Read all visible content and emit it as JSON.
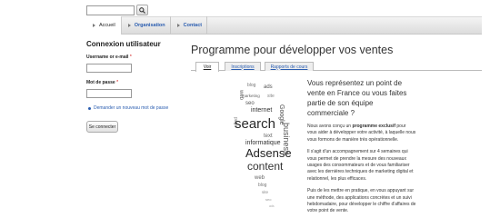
{
  "search": {
    "value": "",
    "button_icon": "search-icon"
  },
  "nav": {
    "items": [
      {
        "label": "Accueil",
        "active": true
      },
      {
        "label": "Organisation",
        "active": false
      },
      {
        "label": "Contact",
        "active": false
      }
    ]
  },
  "login": {
    "title": "Connexion utilisateur",
    "username_label": "Username or e-mail",
    "password_label": "Mot de passe",
    "required_mark": "*",
    "new_password_link": "Demander un nouveau mot de passe",
    "submit_label": "Se connecter"
  },
  "main": {
    "title": "Programme pour développer vos ventes",
    "tabs": [
      {
        "label": "Voir",
        "active": true
      },
      {
        "label": "Inscriptions",
        "active": false
      },
      {
        "label": "Rapports de cours",
        "active": false
      }
    ],
    "lead": "Vous représentez un point de vente en France ou vous faites partie de son équipe commerciale ?",
    "p1_before": "Nous avons conçu un ",
    "p1_strong": "programme exclusif",
    "p1_after": " pour vous aider à développer votre activité, à laquelle nous vous formons de manière très opérationnelle.",
    "p2": "Il s'agit d'un accompagnement sur 4 semaines qui vous permet de prendre la mesure des nouveaux usages des consommateurs et de vous familiariser avec les dernières techniques de marketing digital et relationnel, les plus efficaces.",
    "p3": "Puis de les mettre en pratique, en vous appuyant sur une méthode, des applications concrètes et un suivi hebdomadaire, pour développer le chiffre d'affaires de votre point de vente."
  },
  "word_cloud": {
    "words": [
      "search",
      "Adsense",
      "content",
      "internet",
      "informatique",
      "business",
      "text",
      "web",
      "blog",
      "Google",
      "ads",
      "marketing",
      "site",
      "seo",
      "page"
    ]
  }
}
